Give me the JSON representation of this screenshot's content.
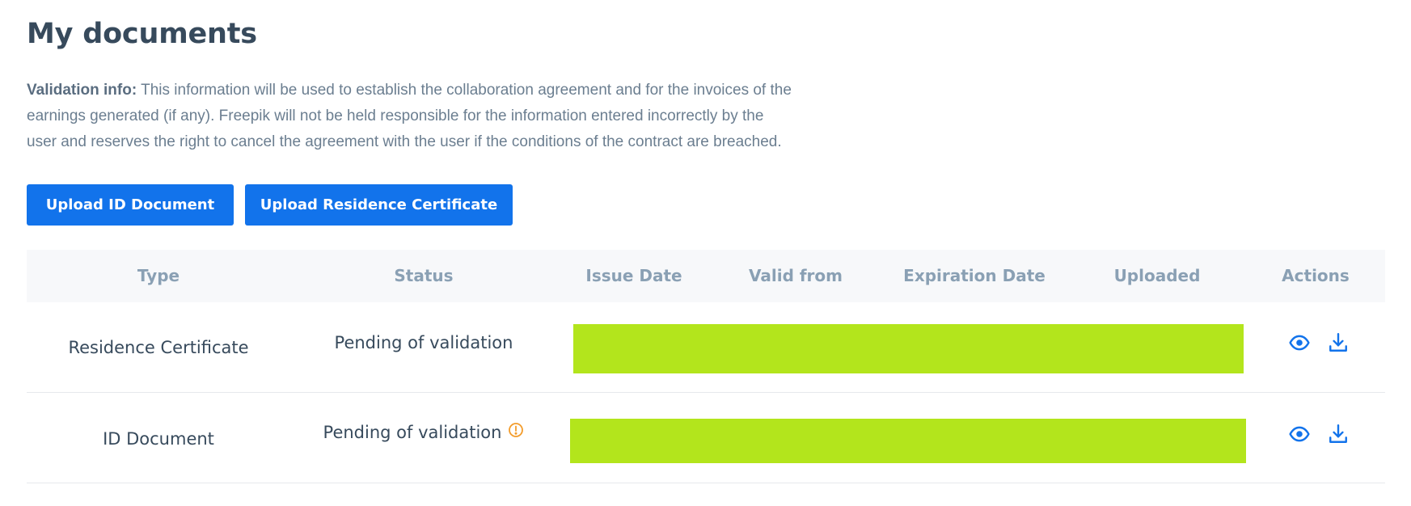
{
  "page": {
    "title": "My documents",
    "info_label": "Validation info:",
    "info_text_line1": " This information will be used to establish the collaboration agreement and for the invoices of the",
    "info_text_line2": "earnings generated (if any). Freepik will not be held responsible for the information entered incorrectly by the",
    "info_text_line3": "user and reserves the right to cancel the agreement with the user if the conditions of the contract are breached."
  },
  "buttons": {
    "upload_id": "Upload ID Document",
    "upload_residence": "Upload Residence Certificate"
  },
  "table": {
    "headers": {
      "type": "Type",
      "status": "Status",
      "issue_date": "Issue Date",
      "valid_from": "Valid from",
      "expiration_date": "Expiration Date",
      "uploaded": "Uploaded",
      "actions": "Actions"
    },
    "rows": [
      {
        "type": "Residence Certificate",
        "status": "Pending of validation",
        "has_warning": false,
        "actions": [
          "eye-icon",
          "download-icon"
        ]
      },
      {
        "type": "ID Document",
        "status": "Pending of validation",
        "has_warning": true,
        "actions": [
          "eye-icon",
          "download-icon"
        ]
      }
    ]
  },
  "colors": {
    "primary_button": "#1273eb",
    "title": "#374a5c",
    "header_text": "#8aa0b4",
    "header_bg": "#f7f8fa",
    "redaction": "#b3e51c",
    "warning": "#f39c2b",
    "action_icon": "#1273eb"
  }
}
